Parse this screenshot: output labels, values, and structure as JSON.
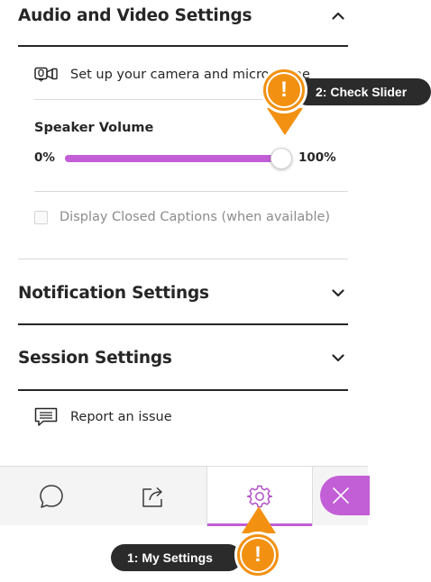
{
  "sections": {
    "audio_video": {
      "title": "Audio and Video Settings"
    },
    "notification": {
      "title": "Notification Settings"
    },
    "session": {
      "title": "Session Settings"
    }
  },
  "camera_setup": {
    "label": "Set up your camera and microphone"
  },
  "speaker_volume": {
    "label": "Speaker Volume",
    "min_label": "0%",
    "max_label": "100%",
    "value_percent": 100
  },
  "captions": {
    "label": "Display Closed Captions (when available)",
    "checked": false
  },
  "report": {
    "label": "Report an issue"
  },
  "tabs": [
    {
      "name": "chat",
      "icon": "chat-icon"
    },
    {
      "name": "share",
      "icon": "share-icon"
    },
    {
      "name": "settings",
      "icon": "gear-icon",
      "active": true
    },
    {
      "name": "close",
      "icon": "close-icon"
    }
  ],
  "callouts": {
    "check_slider": {
      "text": "2: Check Slider",
      "mark": "!"
    },
    "my_settings": {
      "text": "1: My Settings",
      "mark": "!"
    }
  },
  "colors": {
    "accent": "#c25ed6",
    "callout": "#f29111",
    "callout_badge": "#2b2b2b",
    "text": "#262626"
  }
}
